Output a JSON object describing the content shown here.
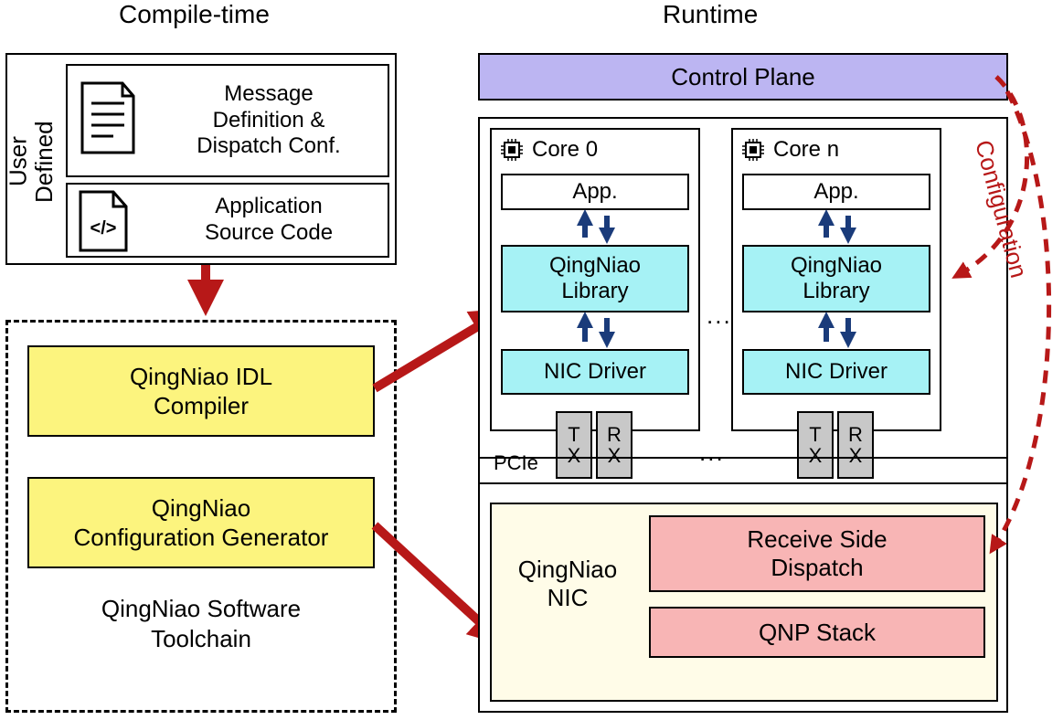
{
  "headings": {
    "compile_time": "Compile-time",
    "runtime": "Runtime"
  },
  "user_defined": {
    "label": "User\nDefined",
    "msg_def": "Message\nDefinition &\nDispatch Conf.",
    "app_src": "Application\nSource Code"
  },
  "toolchain": {
    "idl_compiler": "QingNiao IDL\nCompiler",
    "config_gen": "QingNiao\nConfiguration Generator",
    "label": "QingNiao Software\nToolchain"
  },
  "runtime_box": {
    "control_plane": "Control Plane",
    "core0": "Core 0",
    "coren": "Core n",
    "app": "App.",
    "library": "QingNiao\nLibrary",
    "nic_driver": "NIC Driver",
    "tx": "T\nX",
    "rx": "R\nX",
    "pcie": "PCIe",
    "ellipsis": "...",
    "nic_label": "QingNiao\nNIC",
    "rsd": "Receive Side\nDispatch",
    "qnp": "QNP Stack"
  },
  "config_label": "Configuration"
}
